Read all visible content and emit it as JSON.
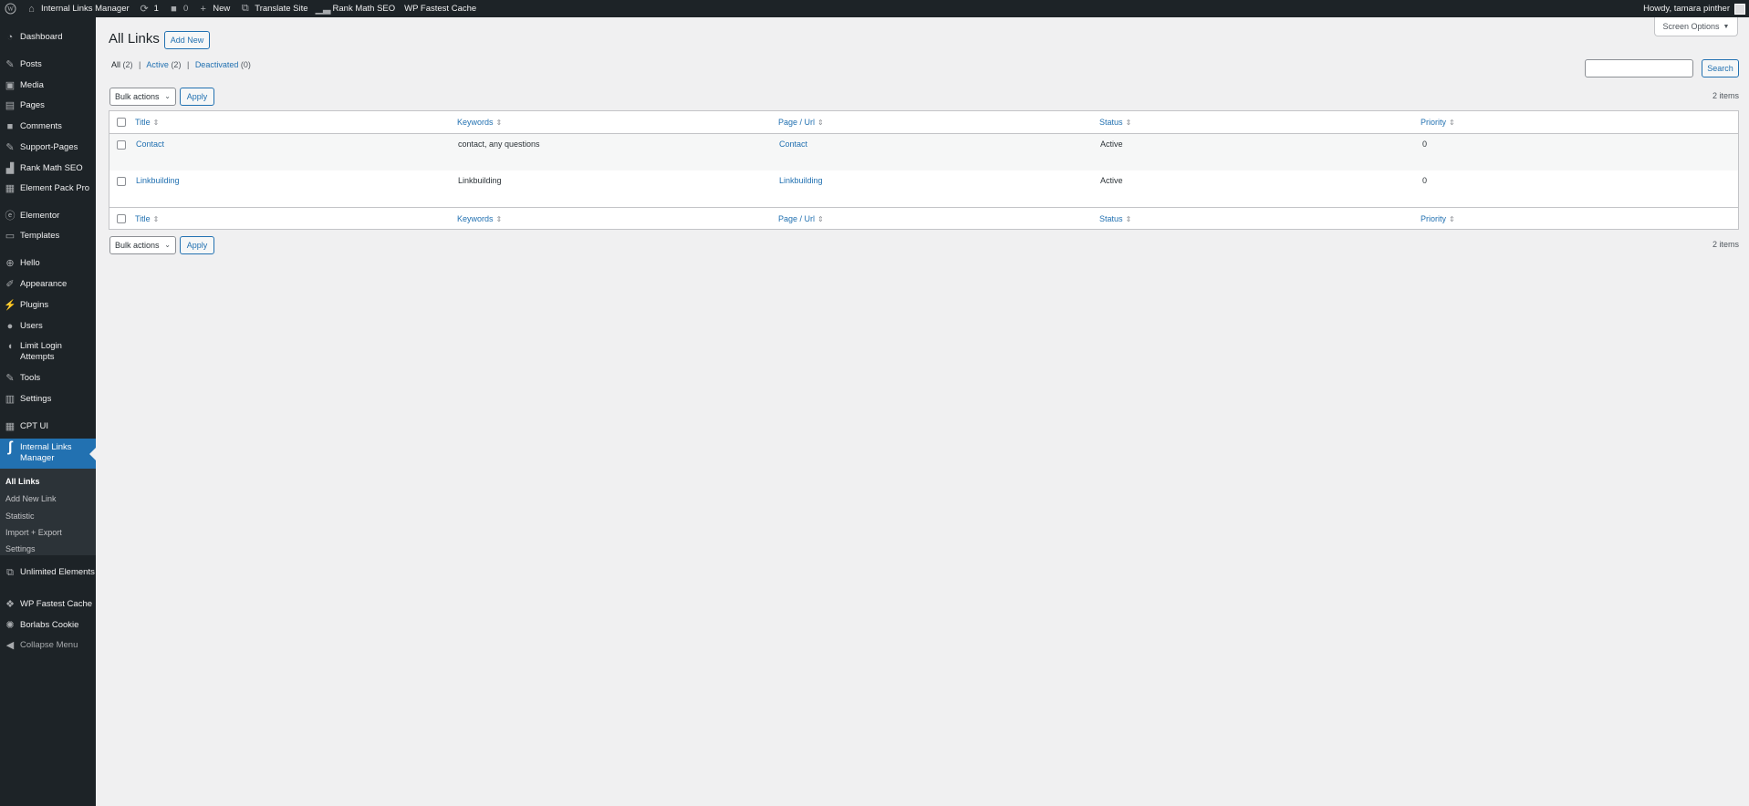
{
  "adminbar": {
    "site_name": "Internal Links Manager",
    "updates_count": "1",
    "comments_count": "0",
    "new_label": "New",
    "translate_label": "Translate Site",
    "rankmath_label": "Rank Math SEO",
    "cache_label": "WP Fastest Cache",
    "howdy": "Howdy, tamara pinther"
  },
  "sidebar": {
    "items": [
      {
        "label": "Dashboard",
        "icon": "dashboard-icon"
      },
      {
        "label": "Posts",
        "icon": "pin-icon"
      },
      {
        "label": "Media",
        "icon": "media-icon"
      },
      {
        "label": "Pages",
        "icon": "page-icon"
      },
      {
        "label": "Comments",
        "icon": "comment-icon"
      },
      {
        "label": "Support-Pages",
        "icon": "pin-icon"
      },
      {
        "label": "Rank Math SEO",
        "icon": "chart-icon"
      },
      {
        "label": "Element Pack Pro",
        "icon": "grid-icon"
      },
      {
        "label": "Elementor",
        "icon": "elementor-icon"
      },
      {
        "label": "Templates",
        "icon": "folder-icon"
      },
      {
        "label": "Hello",
        "icon": "plus-circle-icon"
      },
      {
        "label": "Appearance",
        "icon": "brush-icon"
      },
      {
        "label": "Plugins",
        "icon": "plug-icon"
      },
      {
        "label": "Users",
        "icon": "user-icon"
      },
      {
        "label": "Limit Login Attempts",
        "icon": "shield-icon"
      },
      {
        "label": "Tools",
        "icon": "wrench-icon"
      },
      {
        "label": "Settings",
        "icon": "settings-icon"
      },
      {
        "label": "CPT UI",
        "icon": "cpt-icon"
      },
      {
        "label": "Internal Links Manager",
        "icon": "link-manager-icon"
      },
      {
        "label": "Unlimited Elements",
        "icon": "elements-icon"
      },
      {
        "label": "WP Fastest Cache",
        "icon": "cheetah-icon"
      },
      {
        "label": "Borlabs Cookie",
        "icon": "cookie-icon"
      }
    ],
    "submenu": [
      "All Links",
      "Add New Link",
      "Statistic",
      "Import + Export",
      "Settings"
    ],
    "collapse_label": "Collapse Menu"
  },
  "screen_options_label": "Screen Options",
  "page": {
    "title": "All Links",
    "add_new_label": "Add New",
    "filters": {
      "all_label": "All",
      "all_count": "(2)",
      "active_label": "Active",
      "active_count": "(2)",
      "deactivated_label": "Deactivated",
      "deactivated_count": "(0)"
    },
    "search_button_label": "Search",
    "bulk_actions_label": "Bulk actions",
    "apply_label": "Apply",
    "items_count": "2 items"
  },
  "table": {
    "columns": [
      "Title",
      "Keywords",
      "Page / Url",
      "Status",
      "Priority"
    ],
    "rows": [
      {
        "title": "Contact",
        "keywords": "contact, any questions",
        "page": "Contact",
        "status": "Active",
        "priority": "0"
      },
      {
        "title": "Linkbuilding",
        "keywords": "Linkbuilding",
        "page": "Linkbuilding",
        "status": "Active",
        "priority": "0"
      }
    ]
  },
  "colors": {
    "accent": "#2271b1",
    "sidebar_bg": "#1d2327",
    "page_bg": "#f0f0f1"
  }
}
